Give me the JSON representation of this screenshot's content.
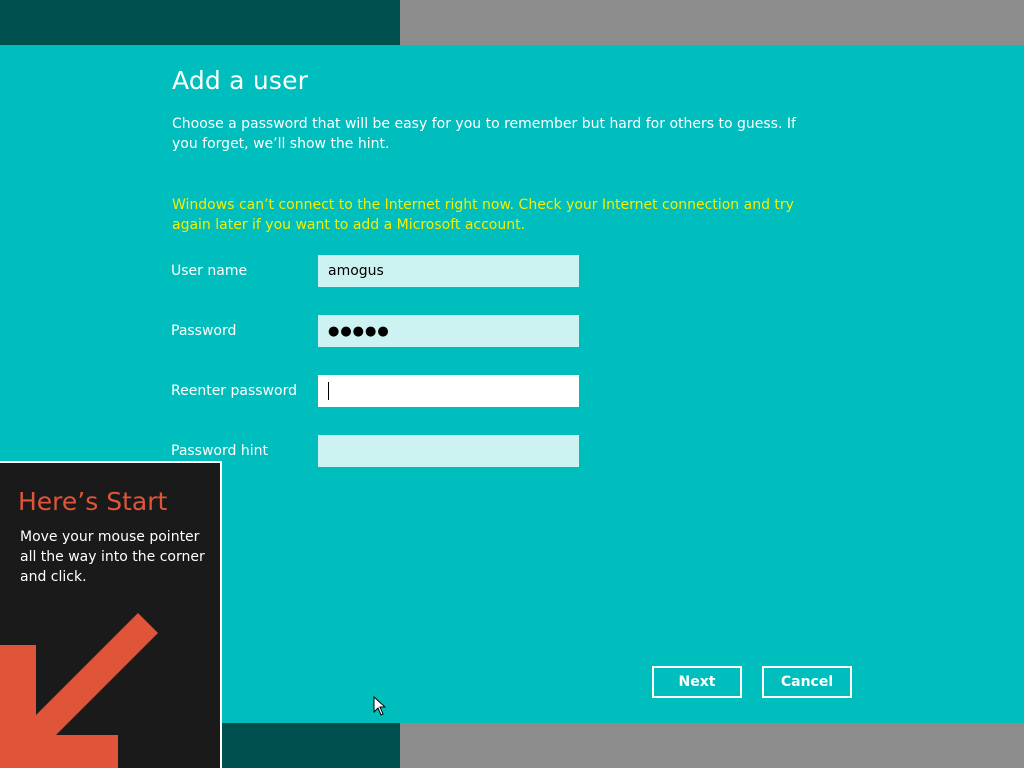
{
  "page": {
    "title": "Add a user",
    "description": "Choose a password that will be easy for you to remember but hard for others to guess. If you forget, we’ll show the hint.",
    "warning": "Windows can’t connect to the Internet right now. Check your Internet connection and try again later if you want to add a Microsoft account."
  },
  "form": {
    "username_label": "User name",
    "username_value": "amogus",
    "password_label": "Password",
    "password_value": "●●●●●",
    "reenter_label": "Reenter password",
    "reenter_value": "",
    "hint_label": "Password hint",
    "hint_value": ""
  },
  "buttons": {
    "next": "Next",
    "cancel": "Cancel"
  },
  "start_tip": {
    "title": "Here’s Start",
    "text": "Move your mouse pointer all the way into the corner and click.",
    "arrow_icon": "arrow-down-left-icon"
  },
  "colors": {
    "background": "#00bebe",
    "dark_band": "#005050",
    "gray_band": "#8c8c8c",
    "warning": "#f0f000",
    "tip_accent": "#e0553a"
  }
}
